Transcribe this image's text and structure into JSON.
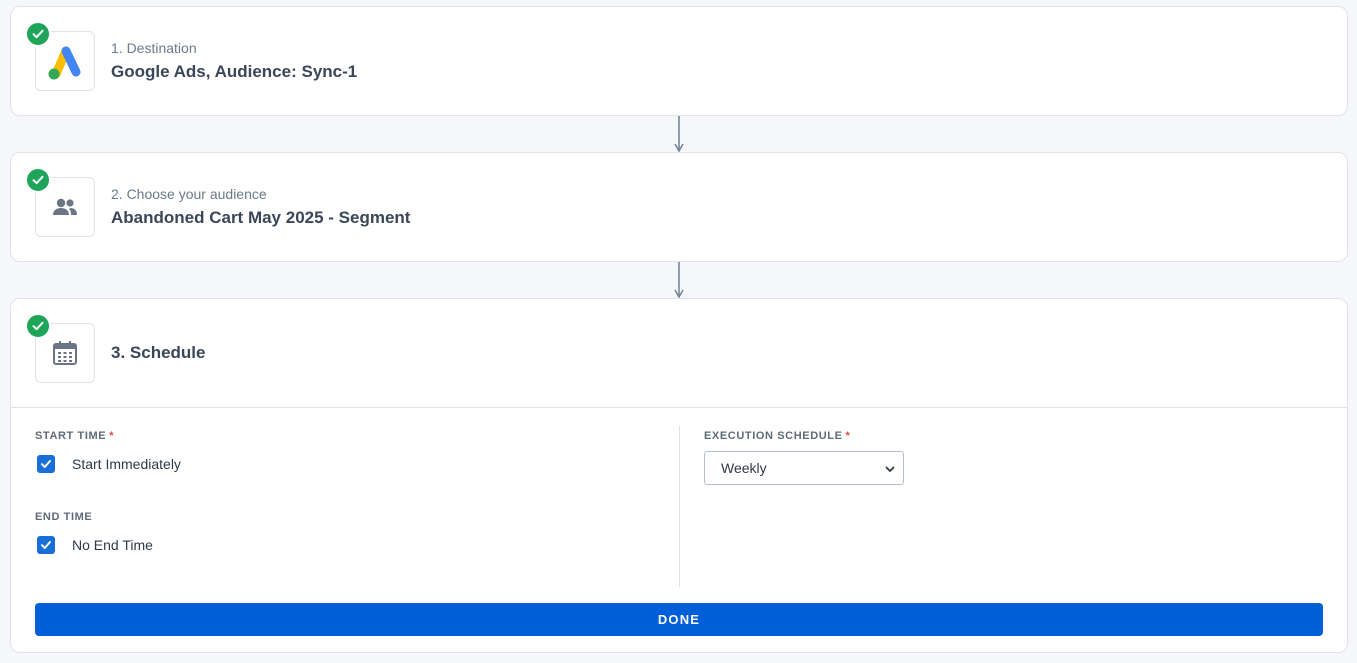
{
  "steps": [
    {
      "subtitle": "1. Destination",
      "title": "Google Ads, Audience: Sync-1",
      "icon": "google-ads-logo"
    },
    {
      "subtitle": "2. Choose your audience",
      "title": "Abandoned Cart May 2025 - Segment",
      "icon": "people-icon"
    },
    {
      "subtitle": "",
      "title": "3. Schedule",
      "icon": "calendar-icon"
    }
  ],
  "schedule": {
    "start_time_label": "START TIME",
    "start_immediately_label": "Start Immediately",
    "start_immediately_checked": true,
    "end_time_label": "END TIME",
    "no_end_time_label": "No End Time",
    "no_end_time_checked": true,
    "execution_label": "EXECUTION SCHEDULE",
    "execution_value": "Weekly",
    "required_mark": "*",
    "done_label": "DONE"
  },
  "colors": {
    "success": "#1fa55a",
    "primary": "#005ed8",
    "checkbox": "#1a6fd6",
    "required": "#e0474c",
    "connector": "#6d8096"
  }
}
